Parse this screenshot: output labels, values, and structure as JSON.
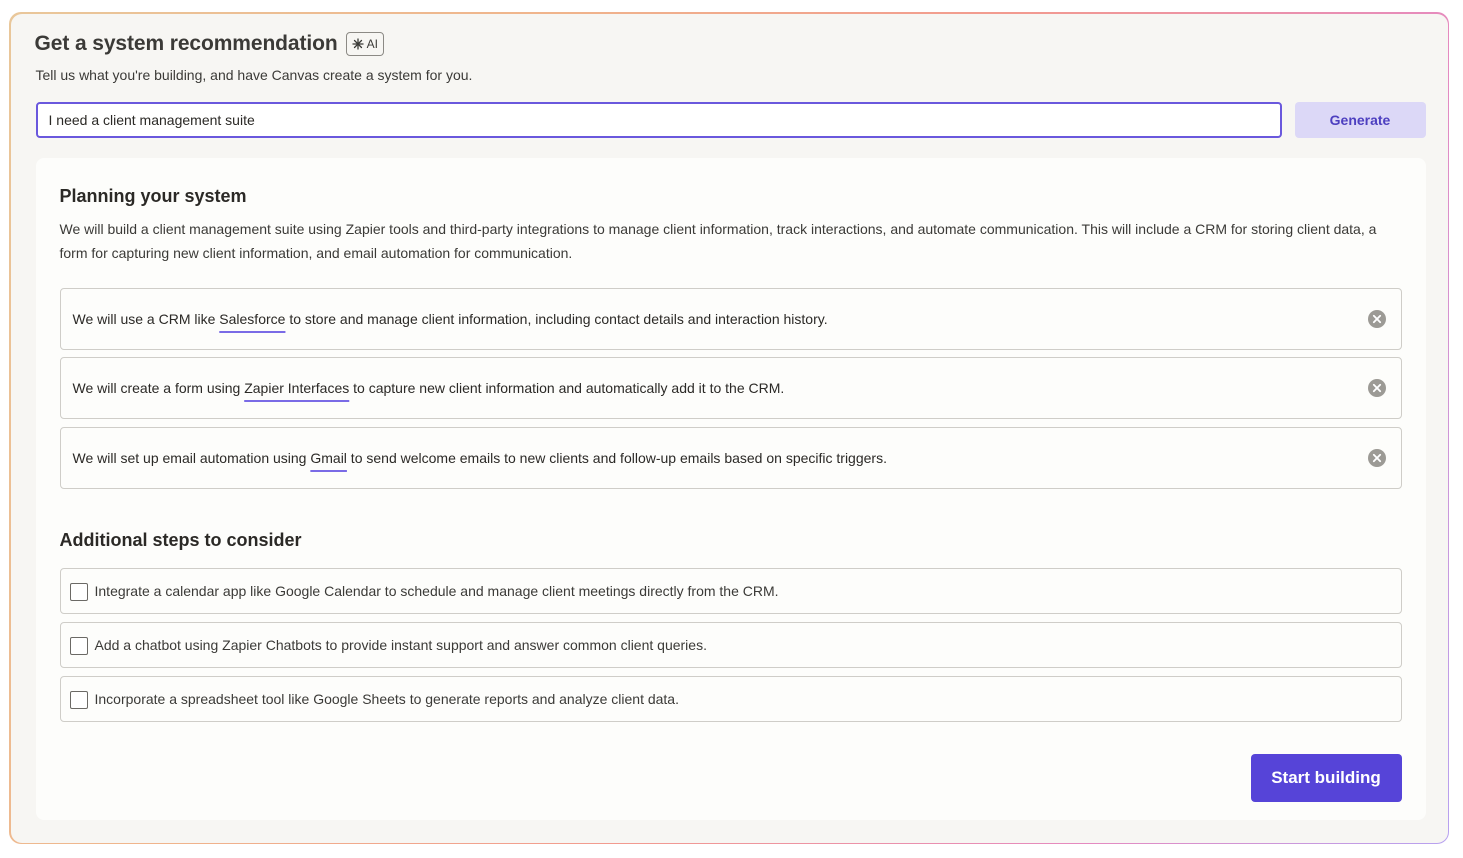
{
  "header": {
    "title": "Get a system recommendation",
    "ai_badge": "AI",
    "subtitle": "Tell us what you're building, and have Canvas create a system for you."
  },
  "prompt": {
    "value": "I need a client management suite",
    "generate_label": "Generate"
  },
  "planning": {
    "title": "Planning your system",
    "description": "We will build a client management suite using Zapier tools and third-party integrations to manage client information, track interactions, and automate communication. This will include a CRM for storing client data, a form for capturing new client information, and email automation for communication.",
    "steps": [
      {
        "before": "We will use a CRM like ",
        "link": "Salesforce",
        "after": " to store and manage client information, including contact details and interaction history."
      },
      {
        "before": "We will create a form using ",
        "link": "Zapier Interfaces",
        "after": " to capture new client information and automatically add it to the CRM."
      },
      {
        "before": "We will set up email automation using ",
        "link": "Gmail",
        "after": " to send welcome emails to new clients and follow-up emails based on specific triggers."
      }
    ]
  },
  "additional": {
    "title": "Additional steps to consider",
    "options": [
      {
        "label": "Integrate a calendar app like Google Calendar to schedule and manage client meetings directly from the CRM.",
        "checked": false
      },
      {
        "label": "Add a chatbot using Zapier Chatbots to provide instant support and answer common client queries.",
        "checked": false
      },
      {
        "label": "Incorporate a spreadsheet tool like Google Sheets to generate reports and analyze client data.",
        "checked": false
      }
    ]
  },
  "actions": {
    "start_label": "Start building"
  },
  "icons": {
    "ai": "sparkle-icon",
    "remove": "close-circle-icon",
    "checkbox": "checkbox-icon"
  },
  "colors": {
    "accent": "#5644d8",
    "accent_light": "#dcd8f7",
    "input_border": "#6a58dd",
    "panel_bg": "#f7f6f3"
  }
}
